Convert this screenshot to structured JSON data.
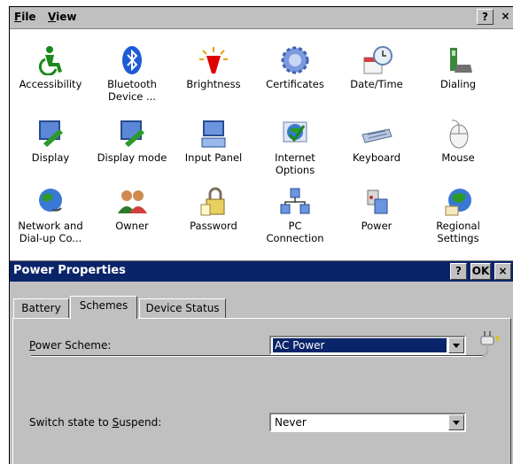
{
  "menubar": {
    "file_label_ul": "F",
    "file_label_rest": "ile",
    "view_label_ul": "V",
    "view_label_rest": "iew",
    "help_label": "?",
    "close_label": "×"
  },
  "control_panel": {
    "items": [
      {
        "label": "Accessibility",
        "icon": "accessibility-icon"
      },
      {
        "label": "Bluetooth\nDevice ...",
        "icon": "bluetooth-icon"
      },
      {
        "label": "Brightness",
        "icon": "brightness-icon"
      },
      {
        "label": "Certificates",
        "icon": "certificates-icon"
      },
      {
        "label": "Date/Time",
        "icon": "date-time-icon"
      },
      {
        "label": "Dialing",
        "icon": "dialing-icon"
      },
      {
        "label": "Display",
        "icon": "display-icon"
      },
      {
        "label": "Display mode",
        "icon": "display-mode-icon"
      },
      {
        "label": "Input Panel",
        "icon": "input-panel-icon"
      },
      {
        "label": "Internet\nOptions",
        "icon": "internet-options-icon"
      },
      {
        "label": "Keyboard",
        "icon": "keyboard-icon"
      },
      {
        "label": "Mouse",
        "icon": "mouse-icon"
      },
      {
        "label": "Network and\nDial-up Co...",
        "icon": "network-icon"
      },
      {
        "label": "Owner",
        "icon": "owner-icon"
      },
      {
        "label": "Password",
        "icon": "password-icon"
      },
      {
        "label": "PC\nConnection",
        "icon": "pc-connection-icon"
      },
      {
        "label": "Power",
        "icon": "power-icon"
      },
      {
        "label": "Regional\nSettings",
        "icon": "regional-settings-icon"
      }
    ]
  },
  "dialog": {
    "title": "Power Properties",
    "help_label": "?",
    "ok_label": "OK",
    "close_label": "×",
    "tabs": [
      "Battery",
      "Schemes",
      "Device Status"
    ],
    "active_tab": "Schemes",
    "power_scheme_label_pre": "",
    "power_scheme_label_ul": "P",
    "power_scheme_label_post": "ower Scheme:",
    "power_scheme_value": "AC Power",
    "suspend_label_pre": "Switch state to ",
    "suspend_label_ul": "S",
    "suspend_label_post": "uspend:",
    "suspend_value": "Never"
  },
  "colors": {
    "title_bar": "#0a246a",
    "face": "#c0c0c0"
  }
}
